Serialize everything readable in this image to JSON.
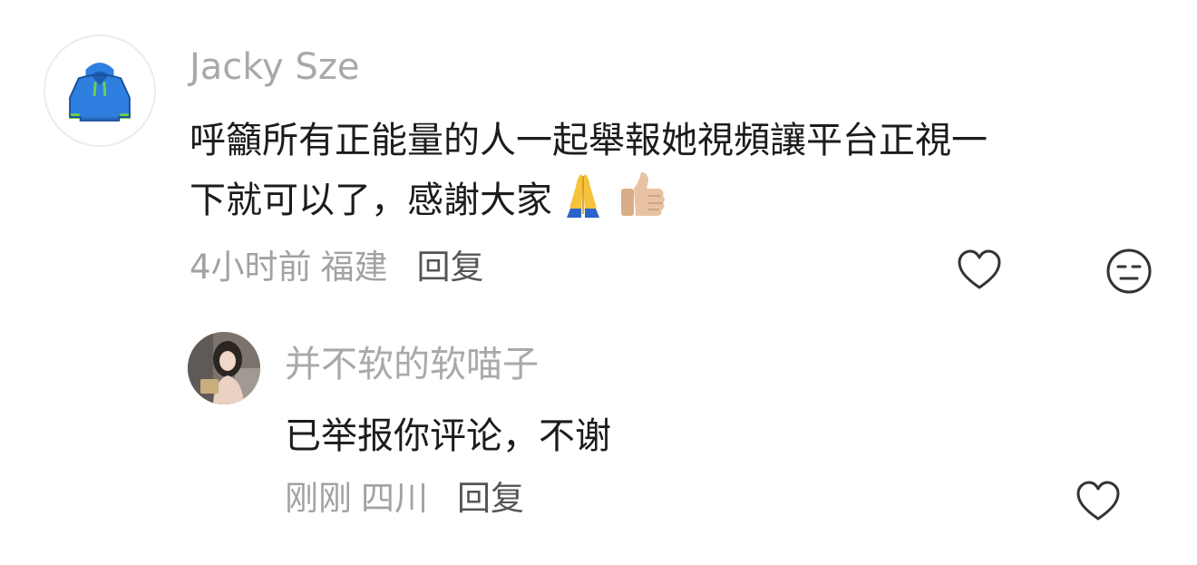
{
  "comments": [
    {
      "username": "Jacky Sze",
      "avatar_icon": "hoodie-icon",
      "text_line1": "呼籲所有正能量的人一起舉報她視頻讓平台正視一",
      "text_line2": "下就可以了，感謝大家",
      "emojis": [
        "folded-hands-emoji",
        "thumbs-up-emoji"
      ],
      "time": "4小时前",
      "location": "福建",
      "reply_label": "回复"
    }
  ],
  "replies": [
    {
      "username": "并不软的软喵子",
      "avatar_icon": "user-photo-avatar",
      "text": "已举报你评论，不谢",
      "time": "刚刚",
      "location": "四川",
      "reply_label": "回复"
    }
  ],
  "colors": {
    "username": "#a9a9a9",
    "text": "#1c1c1c",
    "meta": "#a2a2a2",
    "reply": "#555555",
    "hoodie": "#2f7fe0",
    "hoodie_cuff": "#6fd14a"
  }
}
